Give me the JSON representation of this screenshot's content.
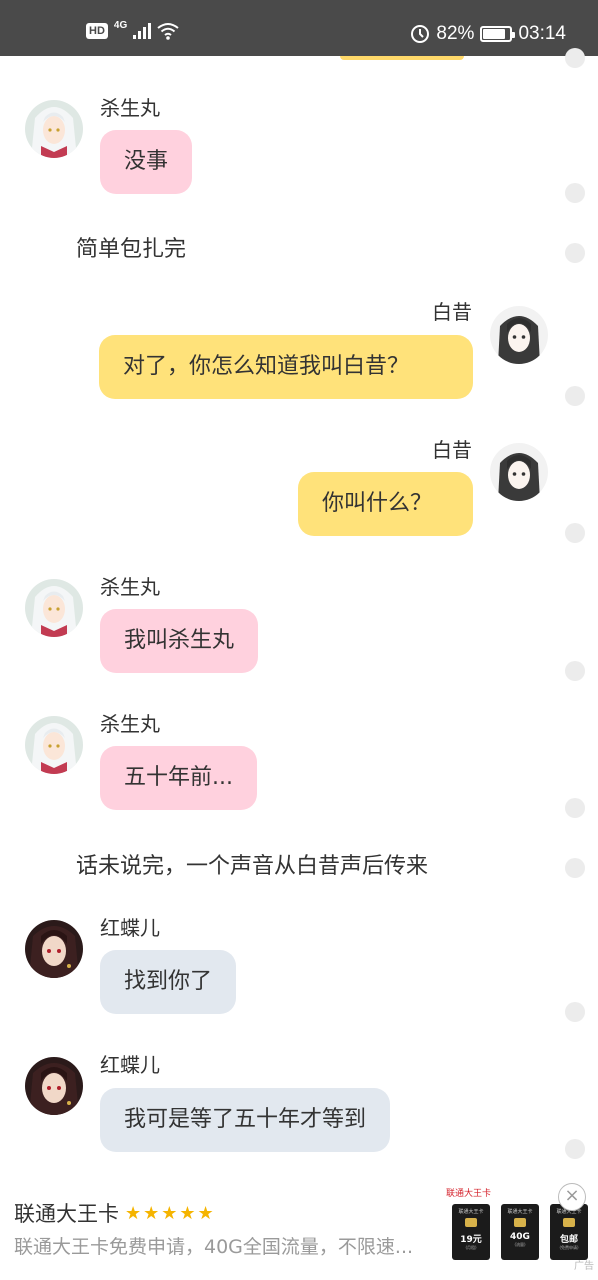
{
  "status_bar": {
    "hd": "HD",
    "network": "4G",
    "battery_percent": "82%",
    "battery_level": 0.82,
    "time": "03:14"
  },
  "conversation": [
    {
      "type": "message",
      "side": "left",
      "name": "杀生丸",
      "text": "没事",
      "bubble_color": "#ffd1de",
      "avatar": "silver-hair-avatar"
    },
    {
      "type": "narration",
      "text": "简单包扎完"
    },
    {
      "type": "message",
      "side": "right",
      "name": "白昔",
      "text": "对了，你怎么知道我叫白昔？",
      "bubble_color": "#ffe27a",
      "avatar": "dark-hair-avatar"
    },
    {
      "type": "message",
      "side": "right",
      "name": "白昔",
      "text": "你叫什么？",
      "bubble_color": "#ffe27a",
      "avatar": "dark-hair-avatar"
    },
    {
      "type": "message",
      "side": "left",
      "name": "杀生丸",
      "text": "我叫杀生丸",
      "bubble_color": "#ffd1de",
      "avatar": "silver-hair-avatar"
    },
    {
      "type": "message",
      "side": "left",
      "name": "杀生丸",
      "text": "五十年前...",
      "bubble_color": "#ffd1de",
      "avatar": "silver-hair-avatar"
    },
    {
      "type": "narration",
      "text": "话未说完，一个声音从白昔声后传来"
    },
    {
      "type": "message",
      "side": "left",
      "name": "红蝶儿",
      "text": "找到你了",
      "bubble_color": "#e2e8ef",
      "avatar": "red-eyed-avatar"
    },
    {
      "type": "message",
      "side": "left",
      "name": "红蝶儿",
      "text": "我可是等了五十年才等到",
      "bubble_color": "#e2e8ef",
      "avatar": "red-eyed-avatar"
    }
  ],
  "ad": {
    "title": "联通大王卡",
    "stars": "★★★★★",
    "description": "联通大王卡免费申请，40G全国流量，不限速...",
    "brand": "联通大王卡",
    "cards": [
      {
        "title": "联通大王卡",
        "value": "19元",
        "sub": "(月租)"
      },
      {
        "title": "联通大王卡",
        "value": "40G",
        "sub": "(流量)"
      },
      {
        "title": "联通大王卡",
        "value": "包邮",
        "sub": "(免费申请)"
      }
    ],
    "close": "×",
    "tag": "广告"
  },
  "colors": {
    "status_bar_bg": "#4a4a4a",
    "pink_bubble": "#ffd1de",
    "yellow_bubble": "#ffe27a",
    "gray_bubble": "#e2e8ef",
    "star": "#f5b400"
  }
}
